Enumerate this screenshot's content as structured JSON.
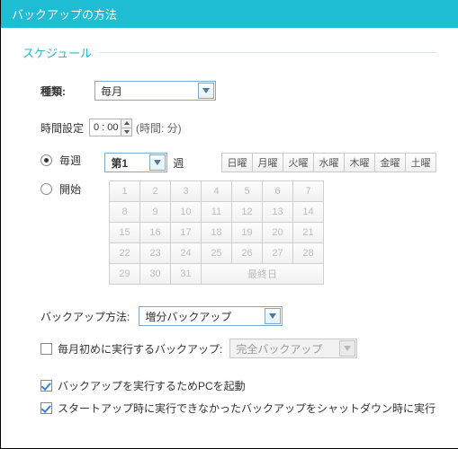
{
  "window": {
    "title": "バックアップの方法"
  },
  "section": {
    "heading": "スケジュール"
  },
  "type_field": {
    "label": "種類:",
    "value": "毎月"
  },
  "time_field": {
    "label": "時間設定",
    "value": "0 : 00",
    "hint": "(時間: 分)"
  },
  "weekly": {
    "label": "毎週",
    "selected_week": "第1",
    "suffix": "週",
    "days": [
      "日曜",
      "月曜",
      "火曜",
      "水曜",
      "木曜",
      "金曜",
      "土曜"
    ]
  },
  "start": {
    "label": "開始",
    "days": [
      "1",
      "2",
      "3",
      "4",
      "5",
      "6",
      "7",
      "8",
      "9",
      "10",
      "11",
      "12",
      "13",
      "14",
      "15",
      "16",
      "17",
      "18",
      "19",
      "20",
      "21",
      "22",
      "23",
      "24",
      "25",
      "26",
      "27",
      "28",
      "29",
      "30",
      "31"
    ],
    "last_day": "最終日"
  },
  "method": {
    "label": "バックアップ方法:",
    "value": "増分バックアップ"
  },
  "first_of_month": {
    "label": "毎月初めに実行するバックアップ:",
    "value": "完全バックアップ"
  },
  "opt_wake": "バックアップを実行するためPCを起動",
  "opt_shutdown": "スタートアップ時に実行できなかったバックアップをシャットダウン時に実行"
}
